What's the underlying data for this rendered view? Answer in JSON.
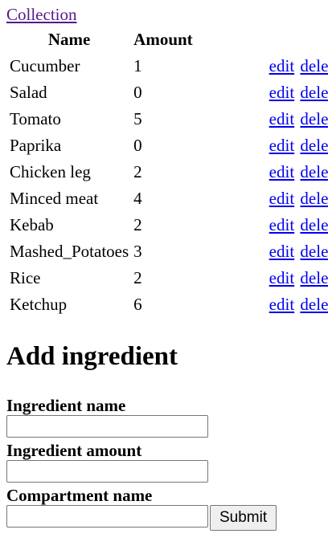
{
  "top_link": "Collection",
  "table": {
    "headers": {
      "name": "Name",
      "amount": "Amount"
    },
    "rows": [
      {
        "name": "Cucumber",
        "amount": "1"
      },
      {
        "name": "Salad",
        "amount": "0"
      },
      {
        "name": "Tomato",
        "amount": "5"
      },
      {
        "name": "Paprika",
        "amount": "0"
      },
      {
        "name": "Chicken leg",
        "amount": "2"
      },
      {
        "name": "Minced meat",
        "amount": "4"
      },
      {
        "name": "Kebab",
        "amount": "2"
      },
      {
        "name": "Mashed_Potatoes",
        "amount": "3"
      },
      {
        "name": "Rice",
        "amount": "2"
      },
      {
        "name": "Ketchup",
        "amount": "6"
      }
    ],
    "edit_label": "edit",
    "delete_label": "delete"
  },
  "form": {
    "heading": "Add ingredient",
    "name_label": "Ingredient name",
    "name_value": "",
    "amount_label": "Ingredient amount",
    "amount_value": "",
    "compartment_label": "Compartment name",
    "compartment_value": "",
    "submit_label": "Submit"
  },
  "colors": {
    "link": "#0000ee",
    "visited_link": "#551a8b"
  }
}
